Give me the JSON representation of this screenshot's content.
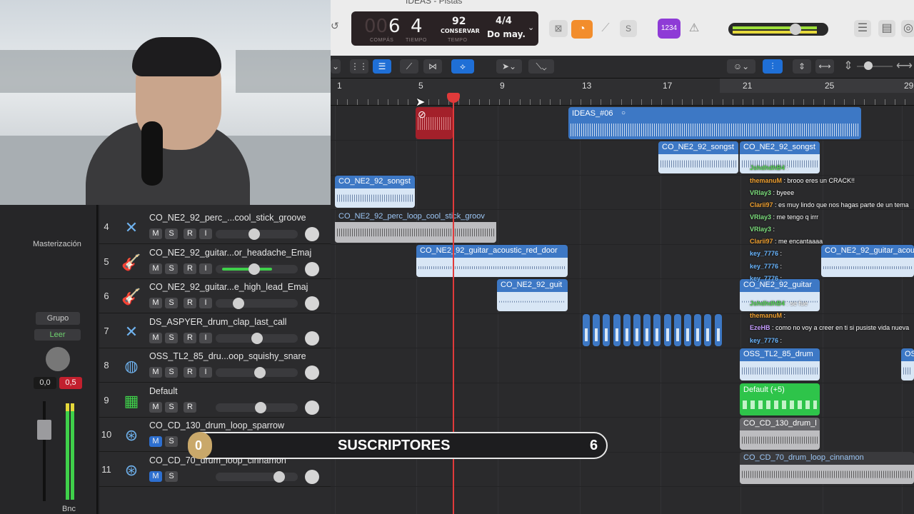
{
  "window": {
    "title": "IDEAS - Pistas"
  },
  "lcd": {
    "bar": "6",
    "beat": "4",
    "bar_label": "COMPÁS",
    "beat_label": "TIEMPO",
    "tempo": "92",
    "tempo_mode": "CONSERVAR",
    "tempo_label": "TEMPO",
    "time_signature": "4/4",
    "key": "Do may."
  },
  "toolbar": {
    "count_in_label": "1234"
  },
  "ruler": {
    "marks": [
      "1",
      "5",
      "9",
      "13",
      "17",
      "21",
      "25",
      "29"
    ]
  },
  "mixer": {
    "mastering_label": "Masterización",
    "group_label": "Grupo",
    "automation_mode": "Leer",
    "volume_value": "0,0",
    "peak_value": "0,5",
    "bounce_label": "Bnc"
  },
  "tracks": [
    {
      "number": "4",
      "name": "CO_NE2_92_perc_...cool_stick_groove",
      "icon": "drum-machine-icon",
      "m": "M",
      "s": "S",
      "r": "R",
      "i": "I"
    },
    {
      "number": "5",
      "name": "CO_NE2_92_guitar...or_headache_Emaj",
      "icon": "guitar-icon",
      "m": "M",
      "s": "S",
      "r": "R",
      "i": "I"
    },
    {
      "number": "6",
      "name": "CO_NE2_92_guitar...e_high_lead_Emaj",
      "icon": "guitar-icon",
      "m": "M",
      "s": "S",
      "r": "R",
      "i": "I"
    },
    {
      "number": "7",
      "name": "DS_ASPYER_drum_clap_last_call",
      "icon": "drum-machine-icon",
      "m": "M",
      "s": "S",
      "r": "R",
      "i": "I"
    },
    {
      "number": "8",
      "name": "OSS_TL2_85_dru...oop_squishy_snare",
      "icon": "snare-drum-icon",
      "m": "M",
      "s": "S",
      "r": "R",
      "i": "I"
    },
    {
      "number": "9",
      "name": "Default",
      "icon": "keyboard-icon",
      "m": "M",
      "s": "S",
      "r": "R",
      "i": ""
    },
    {
      "number": "10",
      "name": "CO_CD_130_drum_loop_sparrow",
      "icon": "drum-kit-icon",
      "m": "M",
      "s": "S",
      "r": "",
      "i": ""
    },
    {
      "number": "11",
      "name": "CO_CD_70_drum_loop_cinnamon",
      "icon": "drum-kit-icon",
      "m": "M",
      "s": "S",
      "r": "",
      "i": ""
    }
  ],
  "regions": {
    "r_ideas": "IDEAS_#06",
    "r_songst1": "CO_NE2_92_songst",
    "r_songst2": "CO_NE2_92_songst",
    "r_songst3": "CO_NE2_92_songst",
    "r_perc": "CO_NE2_92_perc_loop_cool_stick_groov",
    "r_guitar_red": "CO_NE2_92_guitar_acoustic_red_door",
    "r_guitar_acou": "CO_NE2_92_guitar_acou",
    "r_guit": "CO_NE2_92_guit",
    "r_guitar2": "CO_NE2_92_guitar",
    "r_oss": "OSS_TL2_85_drum",
    "r_oss2": "OS",
    "r_default": "Default (+5)",
    "r_cd130": "CO_CD_130_drum_l",
    "r_cd70": "CO_CD_70_drum_loop_cinnamon"
  },
  "chat": [
    {
      "user": "JshdhdhB4",
      "msg": "",
      "color": "#4fd14f"
    },
    {
      "user": "themanuM",
      "msg": "brooo eres un CRACK!!",
      "color": "#f0a030"
    },
    {
      "user": "VRlay3",
      "msg": "byeee",
      "color": "#7ee07e"
    },
    {
      "user": "Clarii97",
      "msg": "es muy lindo que nos hagas parte de un tema",
      "color": "#f0a030"
    },
    {
      "user": "VRlay3",
      "msg": "me tengo q irrr",
      "color": "#7ee07e"
    },
    {
      "user": "VRlay3",
      "msg": "",
      "color": "#7ee07e"
    },
    {
      "user": "Clarii97",
      "msg": "me encantaaaa",
      "color": "#f0a030"
    },
    {
      "user": "key_7776",
      "msg": "",
      "color": "#6ab6ff"
    },
    {
      "user": "key_7776",
      "msg": "",
      "color": "#6ab6ff"
    },
    {
      "user": "key_7776",
      "msg": "",
      "color": "#6ab6ff"
    },
    {
      "user": "JshdhdhB4",
      "msg": "se fue",
      "color": "#4fd14f"
    },
    {
      "user": "themanuM",
      "msg": "",
      "color": "#f0a030"
    },
    {
      "user": "EzeHB",
      "msg": "como no voy a creer en ti si pusiste vida nueva",
      "color": "#c59cff"
    },
    {
      "user": "key_7776",
      "msg": "",
      "color": "#6ab6ff"
    }
  ],
  "subscribers": {
    "label": "SUSCRIPTORES",
    "current": "0",
    "goal": "6",
    "progress": 0
  },
  "colors": {
    "accent": "#2d6fd0",
    "region_blue": "#3d78c5",
    "region_green": "#2ec44a",
    "playhead": "#e03a3a",
    "mute_active": "#2d6fd0",
    "peak": "#c2202e"
  }
}
